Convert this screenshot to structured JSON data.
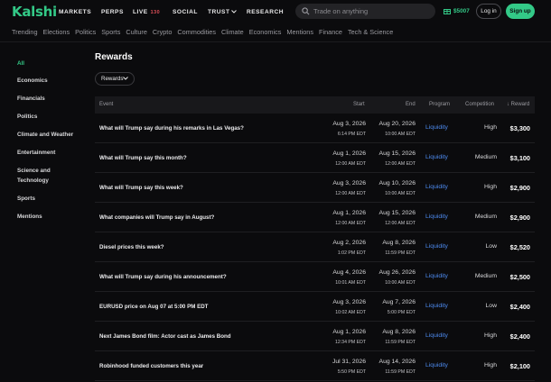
{
  "brand": {
    "name": "Kalshi",
    "accent": "#33c987"
  },
  "nav": {
    "markets": "MARKETS",
    "perps": "PERPS",
    "live": "LIVE",
    "live_count": "130",
    "social": "SOCIAL",
    "trust": "TRUST",
    "research": "RESEARCH"
  },
  "search": {
    "placeholder": "Trade on anything"
  },
  "wallet": {
    "balance": "$5007"
  },
  "auth": {
    "login": "Log in",
    "signup": "Sign up"
  },
  "categories": [
    "Trending",
    "Elections",
    "Politics",
    "Sports",
    "Culture",
    "Crypto",
    "Commodities",
    "Climate",
    "Economics",
    "Mentions",
    "Finance",
    "Tech & Science"
  ],
  "sidebar": {
    "items": [
      {
        "label": "All"
      },
      {
        "label": "Economics"
      },
      {
        "label": "Financials"
      },
      {
        "label": "Politics"
      },
      {
        "label": "Climate and Weather"
      },
      {
        "label": "Entertainment"
      },
      {
        "label": "Science and Technology"
      },
      {
        "label": "Sports"
      },
      {
        "label": "Mentions"
      }
    ]
  },
  "main": {
    "title": "Rewards",
    "filter_label": "Rewards",
    "columns": {
      "event": "Event",
      "start": "Start",
      "end": "End",
      "program": "Program",
      "competition": "Competition",
      "reward": "Reward"
    },
    "rows": [
      {
        "event": "What will Trump say during his remarks in Las Vegas?",
        "start_date": "Aug 3, 2026",
        "start_time": "6:14 PM EDT",
        "end_date": "Aug 20, 2026",
        "end_time": "10:00 AM EDT",
        "program": "Liquidity",
        "competition": "High",
        "reward": "$3,300"
      },
      {
        "event": "What will Trump say this month?",
        "start_date": "Aug 1, 2026",
        "start_time": "12:00 AM EDT",
        "end_date": "Aug 15, 2026",
        "end_time": "12:00 AM EDT",
        "program": "Liquidity",
        "competition": "Medium",
        "reward": "$3,100"
      },
      {
        "event": "What will Trump say this week?",
        "start_date": "Aug 3, 2026",
        "start_time": "12:00 AM EDT",
        "end_date": "Aug 10, 2026",
        "end_time": "10:00 AM EDT",
        "program": "Liquidity",
        "competition": "High",
        "reward": "$2,900"
      },
      {
        "event": "What companies will Trump say in August?",
        "start_date": "Aug 1, 2026",
        "start_time": "12:00 AM EDT",
        "end_date": "Aug 15, 2026",
        "end_time": "12:00 AM EDT",
        "program": "Liquidity",
        "competition": "Medium",
        "reward": "$2,900"
      },
      {
        "event": "Diesel prices this week?",
        "start_date": "Aug 2, 2026",
        "start_time": "1:02 PM EDT",
        "end_date": "Aug 8, 2026",
        "end_time": "11:59 PM EDT",
        "program": "Liquidity",
        "competition": "Low",
        "reward": "$2,520"
      },
      {
        "event": "What will Trump say during his announcement?",
        "start_date": "Aug 4, 2026",
        "start_time": "10:01 AM EDT",
        "end_date": "Aug 26, 2026",
        "end_time": "10:00 AM EDT",
        "program": "Liquidity",
        "competition": "Medium",
        "reward": "$2,500"
      },
      {
        "event": "EURUSD price on Aug 07 at 5:00 PM EDT",
        "start_date": "Aug 3, 2026",
        "start_time": "10:02 AM EDT",
        "end_date": "Aug 7, 2026",
        "end_time": "5:00 PM EDT",
        "program": "Liquidity",
        "competition": "Low",
        "reward": "$2,400"
      },
      {
        "event": "Next James Bond film: Actor cast as James Bond",
        "start_date": "Aug 1, 2026",
        "start_time": "12:34 PM EDT",
        "end_date": "Aug 8, 2026",
        "end_time": "11:59 PM EDT",
        "program": "Liquidity",
        "competition": "High",
        "reward": "$2,400"
      },
      {
        "event": "Robinhood funded customers this year",
        "start_date": "Jul 31, 2026",
        "start_time": "5:50 PM EDT",
        "end_date": "Aug 14, 2026",
        "end_time": "11:59 PM EDT",
        "program": "Liquidity",
        "competition": "High",
        "reward": "$2,100"
      }
    ]
  }
}
